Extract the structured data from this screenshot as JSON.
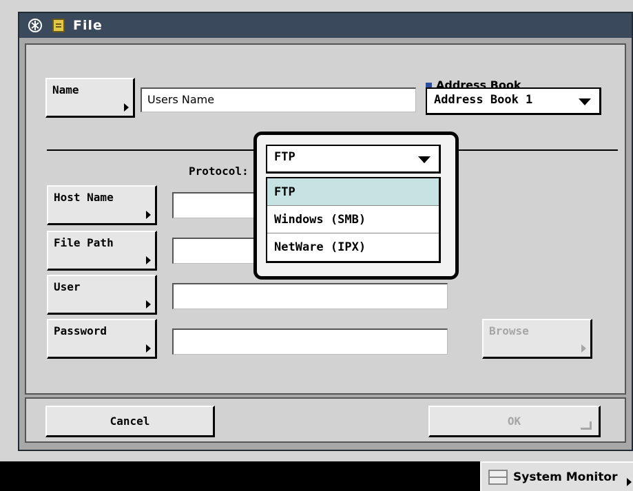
{
  "window": {
    "title": "File",
    "accent_color": "#3a4a5c"
  },
  "name_section": {
    "name_button_label": "Name",
    "name_value": "Users Name",
    "address_book_label": "Address Book",
    "address_book_selected": "Address Book 1"
  },
  "protocol": {
    "label": "Protocol:",
    "selected": "FTP",
    "options": [
      "FTP",
      "Windows (SMB)",
      "NetWare (IPX)"
    ]
  },
  "fields": {
    "host_name_label": "Host Name",
    "host_name_value": "",
    "file_path_label": "File Path",
    "file_path_value": "",
    "user_label": "User",
    "user_value": "",
    "password_label": "Password",
    "password_value": ""
  },
  "buttons": {
    "browse": "Browse",
    "cancel": "Cancel",
    "ok": "OK"
  },
  "status_bar": {
    "system_monitor": "System Monitor"
  },
  "icons": {
    "app": "app-menu-icon",
    "file": "file-folder-icon",
    "monitor": "system-monitor-icon"
  }
}
